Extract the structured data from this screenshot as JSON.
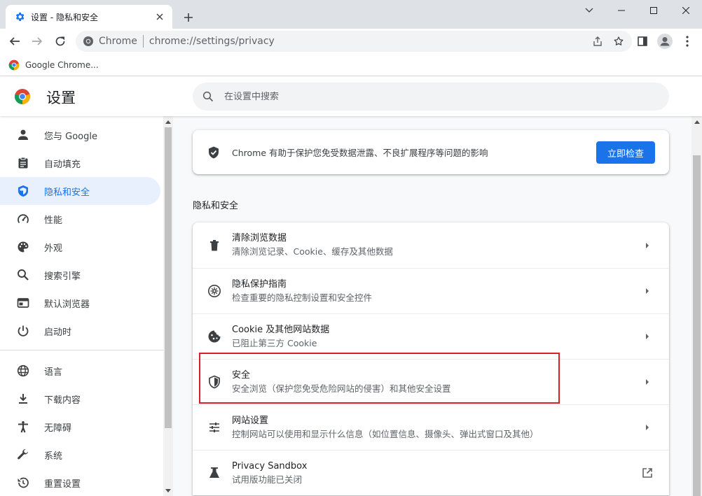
{
  "browser": {
    "tab_title": "设置 - 隐私和安全",
    "site_name": "Chrome",
    "url": "chrome://settings/privacy",
    "bookmark_label": "Google Chrome..."
  },
  "header": {
    "title": "设置",
    "search_placeholder": "在设置中搜索"
  },
  "sidebar": {
    "items": [
      {
        "label": "您与 Google",
        "icon": "person-icon"
      },
      {
        "label": "自动填充",
        "icon": "clipboard-icon"
      },
      {
        "label": "隐私和安全",
        "icon": "shield-icon"
      },
      {
        "label": "性能",
        "icon": "speedometer-icon"
      },
      {
        "label": "外观",
        "icon": "palette-icon"
      },
      {
        "label": "搜索引擎",
        "icon": "search-icon"
      },
      {
        "label": "默认浏览器",
        "icon": "browser-icon"
      },
      {
        "label": "启动时",
        "icon": "power-icon"
      },
      {
        "label": "语言",
        "icon": "globe-icon"
      },
      {
        "label": "下载内容",
        "icon": "download-icon"
      },
      {
        "label": "无障碍",
        "icon": "accessibility-icon"
      },
      {
        "label": "系统",
        "icon": "wrench-icon"
      },
      {
        "label": "重置设置",
        "icon": "history-icon"
      }
    ],
    "active_index": 2
  },
  "safety_check": {
    "text": "Chrome 有助于保护您免受数据泄露、不良扩展程序等问题的影响",
    "button_label": "立即检查"
  },
  "privacy": {
    "section_title": "隐私和安全",
    "rows": [
      {
        "title": "清除浏览数据",
        "subtitle": "清除浏览记录、Cookie、缓存及其他数据",
        "icon": "trash-icon"
      },
      {
        "title": "隐私保护指南",
        "subtitle": "检查重要的隐私控制设置和安全控件",
        "icon": "compass-icon"
      },
      {
        "title": "Cookie 及其他网站数据",
        "subtitle": "已阻止第三方 Cookie",
        "icon": "cookie-icon"
      },
      {
        "title": "安全",
        "subtitle": "安全浏览（保护您免受危险网站的侵害）和其他安全设置",
        "icon": "security-shield-icon"
      },
      {
        "title": "网站设置",
        "subtitle": "控制网站可以使用和显示什么信息（如位置信息、摄像头、弹出式窗口及其他）",
        "icon": "sliders-icon"
      },
      {
        "title": "Privacy Sandbox",
        "subtitle": "试用版功能已关闭",
        "icon": "flask-icon"
      }
    ]
  },
  "colors": {
    "accent": "#1a73e8",
    "highlight": "#d9202a"
  }
}
